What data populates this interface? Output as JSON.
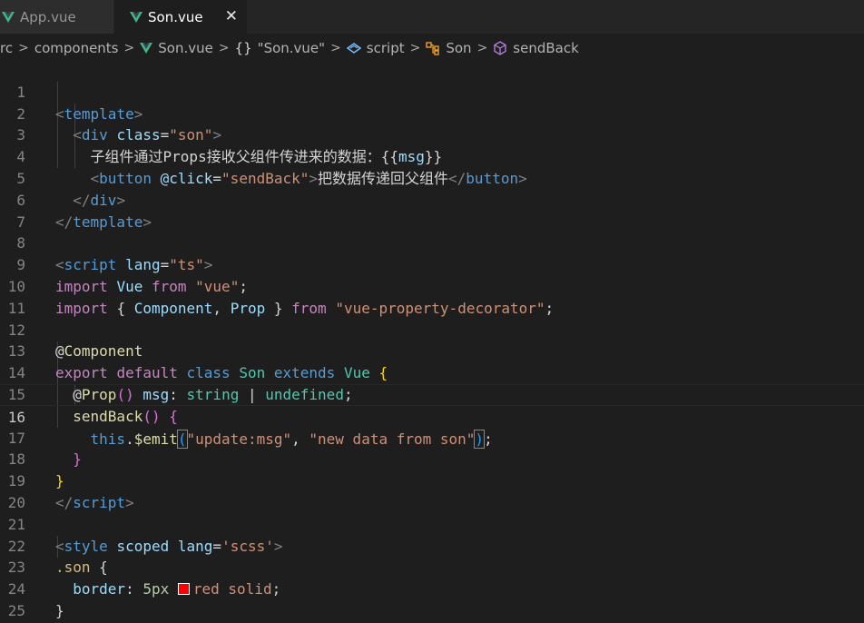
{
  "tabs": [
    {
      "label": "App.vue",
      "active": false
    },
    {
      "label": "Son.vue",
      "active": true
    }
  ],
  "tab_close_glyph": "✕",
  "breadcrumb": {
    "items": [
      "rc",
      "components",
      "Son.vue",
      "\"Son.vue\"",
      "script",
      "Son",
      "sendBack"
    ],
    "braces": "{}"
  },
  "colors": {
    "vue_green": "#41b883",
    "swatch_red": "#ff0000"
  },
  "lines": [
    {
      "n": "1"
    },
    {
      "n": "2"
    },
    {
      "n": "3"
    },
    {
      "n": "4"
    },
    {
      "n": "5"
    },
    {
      "n": "6"
    },
    {
      "n": "7"
    },
    {
      "n": "8"
    },
    {
      "n": "9"
    },
    {
      "n": "10"
    },
    {
      "n": "11"
    },
    {
      "n": "12"
    },
    {
      "n": "13"
    },
    {
      "n": "14"
    },
    {
      "n": "15"
    },
    {
      "n": "16"
    },
    {
      "n": "17"
    },
    {
      "n": "18"
    },
    {
      "n": "19"
    },
    {
      "n": "20"
    },
    {
      "n": "21"
    },
    {
      "n": "22"
    },
    {
      "n": "23"
    },
    {
      "n": "24"
    },
    {
      "n": "25"
    }
  ],
  "code": {
    "l1": {
      "open": "<",
      "tag": "template",
      "close": ">"
    },
    "l2": {
      "open": "<",
      "tag": "div",
      "attr": "class",
      "eq": "=",
      "val": "\"son\"",
      "close": ">"
    },
    "l3": {
      "text": "子组件通过Props接收父组件传进来的数据：",
      "ob": "{{",
      "var": "msg",
      "cb": "}}"
    },
    "l4": {
      "open": "<",
      "tag": "button",
      "attr": "@click",
      "eq": "=",
      "val": "\"sendBack\"",
      "close": ">",
      "text": "把数据传递回父组件",
      "endopen": "</",
      "endtag": "button",
      "endclose": ">"
    },
    "l5": {
      "open": "</",
      "tag": "div",
      "close": ">"
    },
    "l6": {
      "open": "</",
      "tag": "template",
      "close": ">"
    },
    "l8": {
      "open": "<",
      "tag": "script",
      "attr": "lang",
      "eq": "=",
      "val": "\"ts\"",
      "close": ">"
    },
    "l9": {
      "kw1": "import",
      "id": "Vue",
      "kw2": "from",
      "str": "\"vue\"",
      "end": ";"
    },
    "l10": {
      "kw1": "import",
      "ob": "{",
      "id1": "Component",
      "comma": ",",
      "id2": "Prop",
      "cb": "}",
      "kw2": "from",
      "str": "\"vue-property-decorator\"",
      "end": ";"
    },
    "l12": {
      "at": "@",
      "dec": "Component"
    },
    "l13": {
      "kw1": "export",
      "kw2": "default",
      "kw3": "class",
      "name": "Son",
      "kw4": "extends",
      "base": "Vue",
      "ob": "{"
    },
    "l14": {
      "at": "@",
      "dec": "Prop",
      "paren": "()",
      "prop": "msg",
      "colon": ":",
      "t1": "string",
      "pipe": "|",
      "t2": "undefined",
      "end": ";"
    },
    "l15": {
      "fn": "sendBack",
      "paren": "()",
      "ob": "{"
    },
    "l16": {
      "this": "this",
      "dot": ".",
      "fn": "$emit",
      "op": "(",
      "s1": "\"update:msg\"",
      "comma": ",",
      "s2": "\"new data from son\"",
      "cp": ")",
      "end": ";"
    },
    "l17": {
      "cb": "}"
    },
    "l18": {
      "cb": "}"
    },
    "l19": {
      "open": "</",
      "tag": "script",
      "close": ">"
    },
    "l21": {
      "open": "<",
      "tag": "style",
      "attr1": "scoped",
      "attr2": "lang",
      "eq": "=",
      "val": "'scss'",
      "close": ">"
    },
    "l22": {
      "sel": ".son",
      "ob": "{"
    },
    "l23": {
      "prop": "border",
      "colon": ":",
      "num": "5px",
      "val": "red solid",
      "end": ";"
    },
    "l24": {
      "cb": "}"
    },
    "l25": {
      "open": "</",
      "tag": "style",
      "close": ">"
    }
  }
}
